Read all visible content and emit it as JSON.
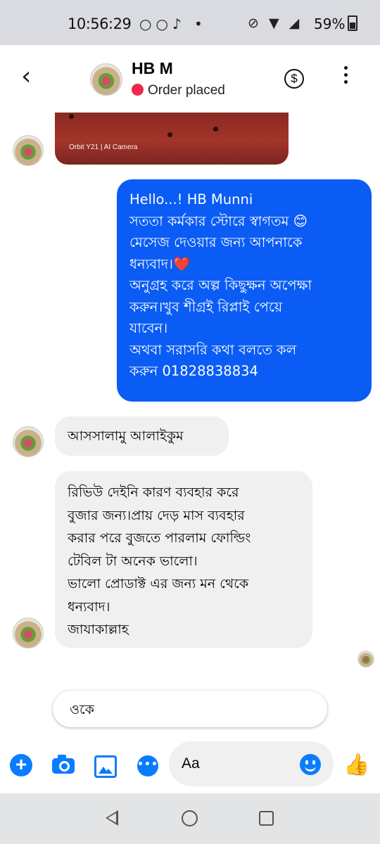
{
  "status_bar": {
    "time": "10:56:29",
    "app_icons": "○○♪ •",
    "right_icons": "⊘ ▼ ◢",
    "battery": "59%"
  },
  "header": {
    "back_icon": "‹",
    "contact_name": "HB M",
    "status": "Order placed",
    "dollar_icon": "$"
  },
  "photo": {
    "camera_label": "Orbit Y21 | AI Camera"
  },
  "messages": {
    "sent_auto_reply": [
      "Hello...! HB Munni",
      "সততা কর্মকার স্টোরে স্বাগতম 😊",
      "মেসেজ দেওয়ার জন্য আপনাকে",
      "ধন্যবাদ।❤️",
      "অনুগ্রহ করে অল্প কিছুক্ষন অপেক্ষা",
      "করুন।খুব শীগ্রই রিপ্লাই পেয়ে",
      "যাবেন।",
      "অথবা সরাসরি কথা বলতে কল",
      "করুন 01828838834"
    ],
    "received_greeting": "আসসালামু আলাইকুম",
    "received_review": [
      "রিভিউ দেইনি কারণ ব্যবহার করে",
      "বুজার জন্য।প্রায় দেড় মাস ব্যবহার",
      "করার পরে বুজতে পারলাম ফোল্ডিং",
      "টেবিল টা অনেক ভালো।",
      "ভালো প্রোডাক্ট এর জন্য মন থেকে",
      "ধন্যবাদ।",
      "জাযাকাল্লাহ"
    ]
  },
  "quick_reply": {
    "label": "ওকে"
  },
  "composer": {
    "plus_icon": "+",
    "chat_icon": "•••",
    "placeholder": "Aa",
    "like_icon": "👍"
  },
  "colors": {
    "accent": "#0a7cff",
    "sent_bubble": "#0a5cf5",
    "received_bubble": "#f0f0f0",
    "status_dot": "#f02849"
  }
}
